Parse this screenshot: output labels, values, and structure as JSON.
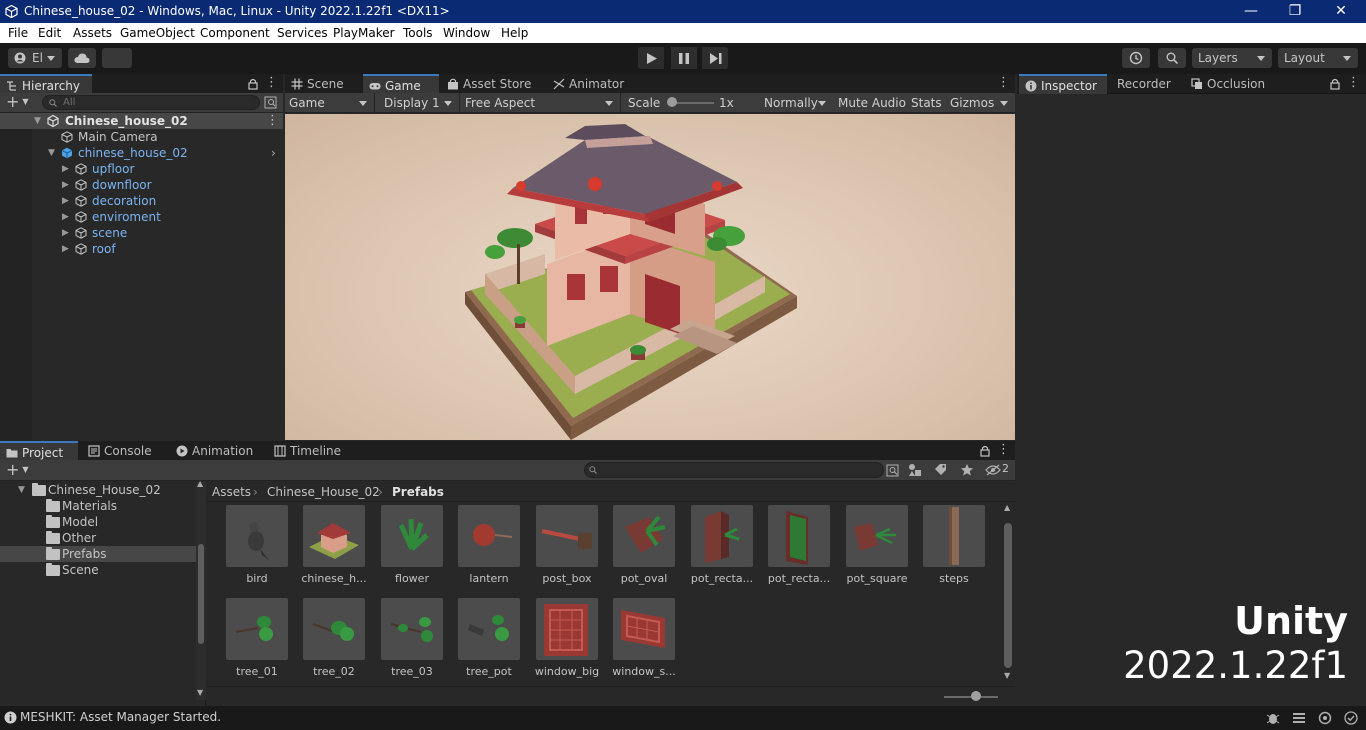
{
  "window": {
    "title": "Chinese_house_02 - Windows, Mac, Linux - Unity 2022.1.22f1 <DX11>",
    "controls": {
      "minimize": "—",
      "restore": "❐",
      "close": "✕"
    }
  },
  "menu": [
    "File",
    "Edit",
    "Assets",
    "GameObject",
    "Component",
    "Services",
    "PlayMaker",
    "Tools",
    "Window",
    "Help"
  ],
  "toolbar": {
    "account_label": "El",
    "layers_label": "Layers",
    "layout_label": "Layout"
  },
  "hierarchy": {
    "tab_label": "Hierarchy",
    "search_placeholder": "All",
    "scene_name": "Chinese_house_02",
    "items": [
      {
        "label": "Main Camera"
      },
      {
        "label": "chinese_house_02"
      },
      {
        "label": "upfloor"
      },
      {
        "label": "downfloor"
      },
      {
        "label": "decoration"
      },
      {
        "label": "enviroment"
      },
      {
        "label": "scene"
      },
      {
        "label": "roof"
      }
    ]
  },
  "center_tabs": [
    {
      "label": "Scene",
      "icon": "grid-icon"
    },
    {
      "label": "Game",
      "icon": "gamepad-icon"
    },
    {
      "label": "Asset Store",
      "icon": "bag-icon"
    },
    {
      "label": "Animator",
      "icon": "animator-icon"
    }
  ],
  "game_toolbar": {
    "view_mode": "Game",
    "display": "Display 1",
    "aspect": "Free Aspect",
    "scale_label": "Scale",
    "scale_value": "1x",
    "scale_level": 0.0,
    "normally": "Normally",
    "mute_audio": "Mute Audio",
    "stats": "Stats",
    "gizmos": "Gizmos"
  },
  "right_tabs": [
    {
      "label": "Inspector",
      "icon": "info-icon"
    },
    {
      "label": "Recorder",
      "icon": ""
    },
    {
      "label": "Occlusion",
      "icon": "occlusion-icon"
    }
  ],
  "bottom_tabs": [
    {
      "label": "Project",
      "icon": "folder-icon"
    },
    {
      "label": "Console",
      "icon": "console-icon"
    },
    {
      "label": "Animation",
      "icon": "animation-icon"
    },
    {
      "label": "Timeline",
      "icon": "timeline-icon"
    }
  ],
  "project": {
    "root_folder": "Chinese_House_02",
    "folders": [
      "Materials",
      "Model",
      "Other",
      "Prefabs",
      "Scene"
    ],
    "selected_folder": "Prefabs",
    "breadcrumb": [
      "Assets",
      "Chinese_House_02",
      "Prefabs"
    ],
    "hidden_count": "2",
    "assets": [
      {
        "name": "bird"
      },
      {
        "name": "chinese_h..."
      },
      {
        "name": "flower"
      },
      {
        "name": "lantern"
      },
      {
        "name": "post_box"
      },
      {
        "name": "pot_oval"
      },
      {
        "name": "pot_recta..."
      },
      {
        "name": "pot_recta..."
      },
      {
        "name": "pot_square"
      },
      {
        "name": "steps"
      },
      {
        "name": "tree_01"
      },
      {
        "name": "tree_02"
      },
      {
        "name": "tree_03"
      },
      {
        "name": "tree_pot"
      },
      {
        "name": "window_big"
      },
      {
        "name": "window_s..."
      }
    ]
  },
  "watermark": {
    "line1": "Unity",
    "line2": "2022.1.22f1"
  },
  "status": {
    "message": "MESHKIT: Asset Manager Started."
  },
  "colors": {
    "title_bar": "#0b2a74",
    "selection": "#3a79bb",
    "link_blue": "#7bb4f2"
  }
}
